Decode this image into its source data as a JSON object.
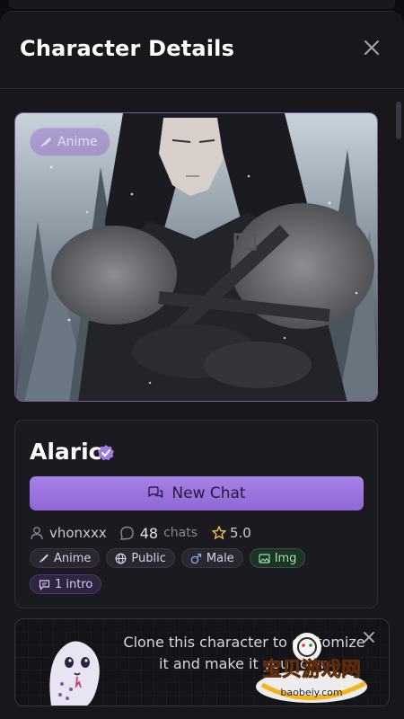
{
  "header": {
    "title": "Character Details"
  },
  "hero": {
    "badge_label": "Anime"
  },
  "character": {
    "name": "Alaric",
    "new_chat_label": "New Chat",
    "creator": "vhonxxx",
    "chats_count": "48",
    "chats_label": "chats",
    "rating": "5.0",
    "tags": [
      {
        "label": "Anime",
        "icon": "brush-icon"
      },
      {
        "label": "Public",
        "icon": "globe-icon"
      },
      {
        "label": "Male",
        "icon": "male-icon"
      },
      {
        "label": "Img",
        "icon": "image-icon"
      }
    ],
    "intro_label": "1 intro"
  },
  "clone_banner": {
    "text": "Clone this character to customize it and make it your own"
  },
  "watermark": {
    "text": "宝贝游戏网",
    "domain": "baobeiy.com"
  },
  "colors": {
    "accent": "#9a74df",
    "sheet": "#18171c",
    "tag_green": "#9be3ad"
  }
}
